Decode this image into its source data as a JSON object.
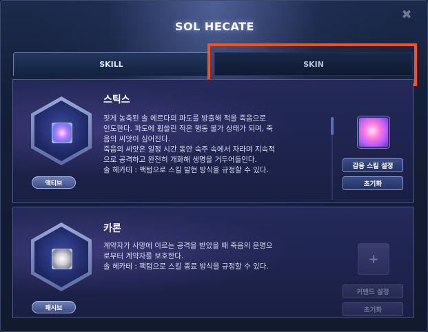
{
  "window": {
    "title": "SOL HECATE"
  },
  "tabs": [
    {
      "label": "SKILL",
      "selected": true
    },
    {
      "label": "SKIN",
      "selected": false
    }
  ],
  "skills": [
    {
      "name": "스틱스",
      "type_label": "액티브",
      "description": "핏게 농축된 솔 에르다의 파도를 방출해 적을 죽음으로\n인도한다. 파도에 휩쓸린 적은 행동 불가 상태가 되며, 죽\n음의 씨앗이 심어진다.\n죽음의 씨앗은 일정 시간 동안 숙주 속에서 자라며 지속적\n으로 공격하고 완전히 개화해 생명을 거두어들인다.\n솔 헤카테 : 팩텀으로 스킬 발현 방식을 규정할 수 있다.",
      "set_button": "감응 스킬 설정",
      "reset_button": "초기화",
      "icon": "stix-skill-icon"
    },
    {
      "name": "카론",
      "type_label": "패시브",
      "description": "계약자가 사망에 이르는 공격을 받았을 때 죽음의 운명으\n로부터 계약자를 보호한다.\n솔 헤카테 : 팩텀으로 스킬 종료 방식을 규정할 수 있다.",
      "set_button": "커맨드 설정",
      "reset_button": "초기화",
      "empty_slot_symbol": "+",
      "icon": "charon-skill-icon"
    }
  ],
  "colors": {
    "highlight": "#ff4f1e",
    "title": "#ffffff",
    "panel": "#1f2550"
  }
}
